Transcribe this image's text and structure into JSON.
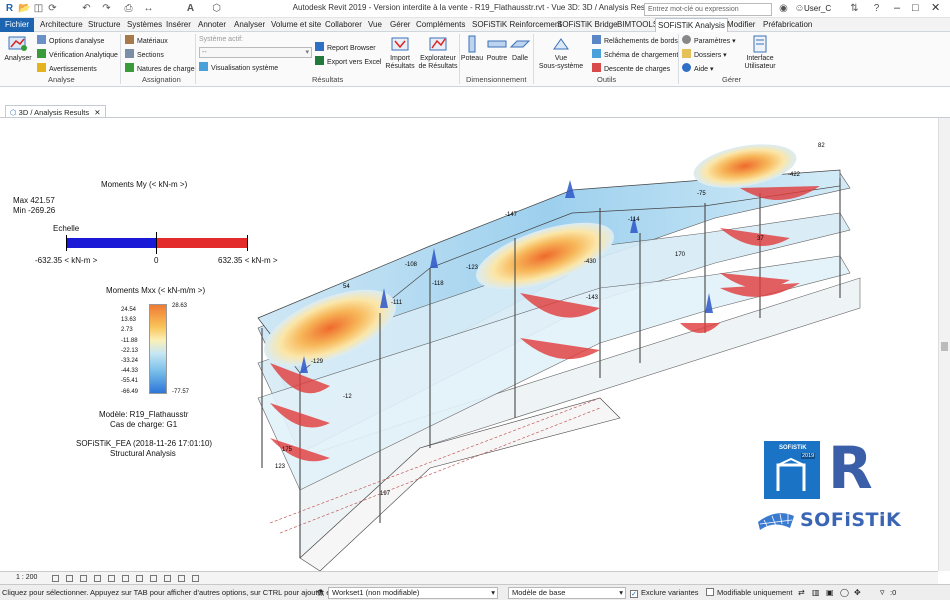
{
  "window": {
    "title": "Autodesk Revit 2019 - Version interdite à la vente - R19_Flathausstr.rvt - Vue 3D: 3D / Analysis Results",
    "search_placeholder": "Entrez mot-clé ou expression",
    "user": "User_C"
  },
  "ribbon_tabs": [
    "Fichier",
    "Architecture",
    "Structure",
    "Systèmes",
    "Insérer",
    "Annoter",
    "Analyser",
    "Volume et site",
    "Collaborer",
    "Vue",
    "Gérer",
    "Compléments",
    "SOFiSTiK Reinforcement",
    "SOFiSTiK Bridge",
    "BIMTOOLS",
    "SOFiSTiK Analysis",
    "Modifier",
    "Préfabrication"
  ],
  "active_tab": "SOFiSTiK Analysis",
  "ribbon": {
    "analyse": {
      "label": "Analyse",
      "big_button": "Analyser",
      "items": [
        "Options d'analyse",
        "Vérification Analytique",
        "Avertissements"
      ]
    },
    "assignation": {
      "label": "Assignation",
      "items": [
        "Matériaux",
        "Sections",
        "Natures de charge"
      ]
    },
    "resultats": {
      "label": "Résultats",
      "system_label": "Système actif:",
      "system_value": "--",
      "visualisation": "Visualisation système",
      "report_browser": "Report Browser",
      "export_excel": "Export vers Excel",
      "import": "Import\nRésultats",
      "explorateur": "Explorateur\nde Résultats"
    },
    "dimensionnement": {
      "label": "Dimensionnement",
      "items": [
        "Poteau",
        "Poutre",
        "Dalle"
      ]
    },
    "outils": {
      "label": "Outils",
      "vue": "Vue\nSous-système",
      "items": [
        "Relâchements de bords",
        "Schéma de chargement",
        "Descente de charges"
      ]
    },
    "gerer": {
      "label": "Gérer",
      "items": [
        "Paramètres",
        "Dossiers",
        "Aide"
      ],
      "interface": "Interface\nUtilisateur"
    }
  },
  "view_tab": "3D / Analysis Results",
  "legend_my": {
    "title": "Moments My (< kN-m >)",
    "max": "Max 421.57",
    "min": "Min -269.26",
    "echelle": "Echelle",
    "left": "-632.35 < kN-m >",
    "center": "0",
    "right": "632.35 < kN-m >",
    "neg_color": "#1a1ad6",
    "pos_color": "#e32b2b"
  },
  "legend_mxx": {
    "title": "Moments Mxx (< kN-m/m >)",
    "ticks": [
      "24.54",
      "13.63",
      "2.73",
      "-11.88",
      "-22.13",
      "-33.24",
      "-44.33",
      "-55.41",
      "-66.49"
    ],
    "top_value": "28.63",
    "bottom_value": "-77.57"
  },
  "model_info": [
    "Modèle: R19_Flathausstr",
    "Cas de charge: G1"
  ],
  "fea_info": [
    "SOFiSTiK_FEA (2018-11-26 17:01:10)",
    "Structural Analysis"
  ],
  "logos": {
    "sofistik_box_name": "SOFiSTiK",
    "sofistik_box_year": "2019",
    "revit_letter": "R",
    "sofistik_word": "SOFiSTiK"
  },
  "model_labels": [
    "82",
    "-422",
    "-75",
    "-147",
    "-114",
    "-108",
    "-430",
    "-123",
    "-118",
    "54",
    "-111",
    "-129",
    "-143",
    "-12",
    "197",
    "175",
    "123",
    "37",
    "170"
  ],
  "view_control": {
    "scale": "1 : 200"
  },
  "status": {
    "message": "Cliquez pour sélectionner. Appuyez sur TAB pour afficher d'autres options, sur CTRL pour ajouter et su",
    "workset": "Workset1 (non modifiable)",
    "model": "Modèle de base",
    "exclude_variants": "Exclure variantes",
    "editable_only": "Modifiable uniquement",
    "filter_count": ":0"
  }
}
